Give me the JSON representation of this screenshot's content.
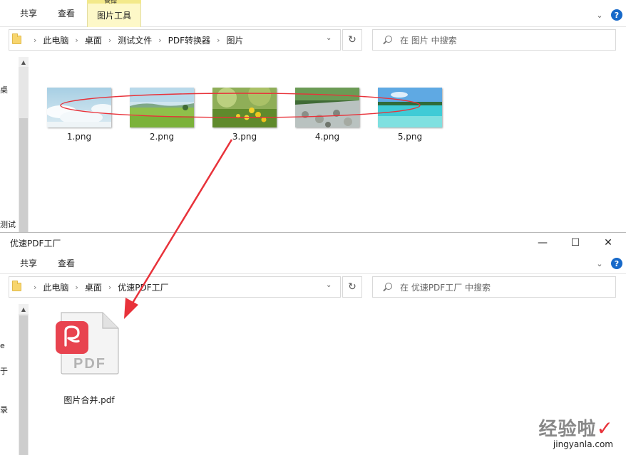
{
  "window1": {
    "ribbon": {
      "tabs": [
        {
          "label": "共享"
        },
        {
          "label": "查看"
        }
      ],
      "context_group": "管理",
      "context_tab": "图片工具"
    },
    "address": {
      "crumbs": [
        "此电脑",
        "桌面",
        "测试文件",
        "PDF转换器",
        "图片"
      ]
    },
    "search": {
      "placeholder": "在 图片 中搜索"
    },
    "sidebar_cut": {
      "top_char": "桌",
      "bottom_text": "测试"
    },
    "files": [
      {
        "name": "1.png",
        "icon": "sky-clouds-thumbnail"
      },
      {
        "name": "2.png",
        "icon": "green-meadow-thumbnail"
      },
      {
        "name": "3.png",
        "icon": "yellow-flowers-thumbnail"
      },
      {
        "name": "4.png",
        "icon": "rocky-stream-thumbnail"
      },
      {
        "name": "5.png",
        "icon": "tropical-sea-thumbnail"
      }
    ]
  },
  "window2": {
    "title": "优速PDF工厂",
    "controls": {
      "minimize": "—",
      "maximize": "☐",
      "close": "✕"
    },
    "ribbon": {
      "tabs": [
        {
          "label": "共享"
        },
        {
          "label": "查看"
        }
      ]
    },
    "address": {
      "crumbs": [
        "此电脑",
        "桌面",
        "优速PDF工厂"
      ]
    },
    "search": {
      "placeholder": "在 优速PDF工厂 中搜索"
    },
    "sidebar_cut": [
      "e",
      "于",
      "录"
    ],
    "output_file": {
      "name": "图片合并.pdf",
      "badge": "PDF",
      "icon": "pdf-file-icon"
    }
  },
  "annotation": {
    "colors": {
      "accent": "#e8323a"
    }
  },
  "watermark": {
    "text": "经验啦",
    "url": "jingyanla.com"
  },
  "colors": {
    "help": "#1769c9",
    "context_tab": "#fdf8c8",
    "pdf_red": "#e8434f"
  }
}
